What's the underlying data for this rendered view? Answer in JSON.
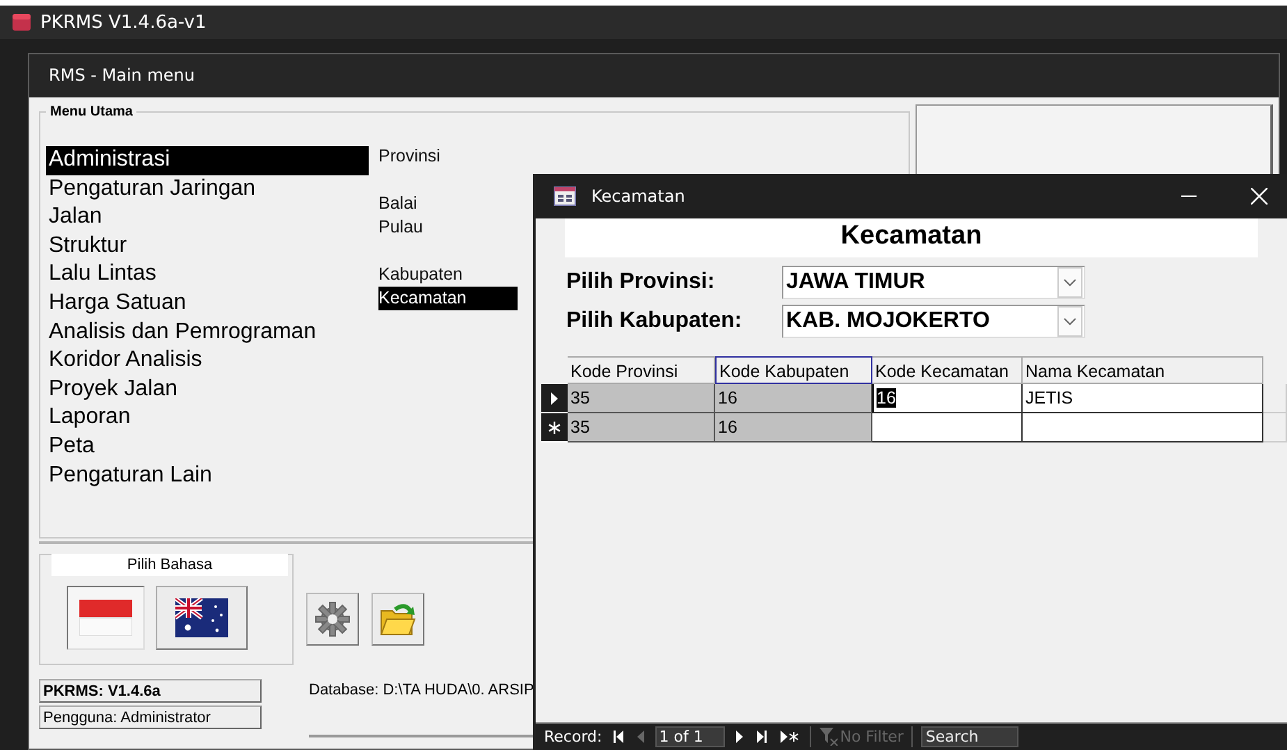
{
  "app": {
    "title": "PKRMS V1.4.6a-v1"
  },
  "main_window": {
    "title": "RMS - Main menu",
    "menu_group": {
      "title": "Menu Utama",
      "items": [
        {
          "label": "Administrasi",
          "selected": true
        },
        {
          "label": "Pengaturan Jaringan",
          "selected": false
        },
        {
          "label": "Jalan",
          "selected": false
        },
        {
          "label": "Struktur",
          "selected": false
        },
        {
          "label": "Lalu Lintas",
          "selected": false
        },
        {
          "label": "Harga Satuan",
          "selected": false
        },
        {
          "label": "Analisis dan Pemrograman",
          "selected": false
        },
        {
          "label": "Koridor Analisis",
          "selected": false
        },
        {
          "label": "Proyek Jalan",
          "selected": false
        },
        {
          "label": "Laporan",
          "selected": false
        },
        {
          "label": "Peta",
          "selected": false
        },
        {
          "label": "Pengaturan Lain",
          "selected": false
        }
      ],
      "sub_groups": [
        {
          "items": [
            {
              "label": "Provinsi",
              "selected": false
            }
          ]
        },
        {
          "items": [
            {
              "label": "Balai",
              "selected": false
            },
            {
              "label": "Pulau",
              "selected": false
            }
          ]
        },
        {
          "items": [
            {
              "label": "Kabupaten",
              "selected": false
            },
            {
              "label": "Kecamatan",
              "selected": true
            }
          ]
        }
      ]
    },
    "language": {
      "title": "Pilih Bahasa",
      "options": [
        {
          "kind": "indonesia",
          "selected": true
        },
        {
          "kind": "australia",
          "selected": false
        }
      ]
    },
    "status": {
      "version": "PKRMS: V1.4.6a",
      "user": "Pengguna: Administrator",
      "database": "Database: D:\\TA HUDA\\0. ARSIP"
    }
  },
  "form_window": {
    "title": "Kecamatan",
    "heading": "Kecamatan",
    "filters": [
      {
        "label": "Pilih Provinsi:",
        "value": "JAWA TIMUR"
      },
      {
        "label": "Pilih Kabupaten:",
        "value": "KAB. MOJOKERTO"
      }
    ],
    "table": {
      "columns": [
        {
          "label": "Kode Provinsi",
          "focused": false
        },
        {
          "label": "Kode Kabupaten",
          "focused": true
        },
        {
          "label": "Kode Kecamatan",
          "focused": false
        },
        {
          "label": "Nama Kecamatan",
          "focused": false
        }
      ],
      "rows": [
        {
          "kind": "current",
          "cells": [
            {
              "text": "35",
              "locked": true,
              "selected": false
            },
            {
              "text": "16",
              "locked": true,
              "selected": false
            },
            {
              "text": "16",
              "locked": false,
              "selected": true
            },
            {
              "text": "JETIS",
              "locked": false,
              "selected": false
            }
          ]
        },
        {
          "kind": "new",
          "cells": [
            {
              "text": "35",
              "locked": true,
              "selected": false
            },
            {
              "text": "16",
              "locked": true,
              "selected": false
            },
            {
              "locked": false,
              "selected": false
            },
            {
              "locked": false,
              "selected": false
            }
          ]
        }
      ]
    },
    "navigation": {
      "label": "Record:",
      "position": "1 of 1",
      "filter": {
        "label": "No Filter",
        "disabled": true
      },
      "search": {
        "placeholder": "Search"
      }
    }
  }
}
